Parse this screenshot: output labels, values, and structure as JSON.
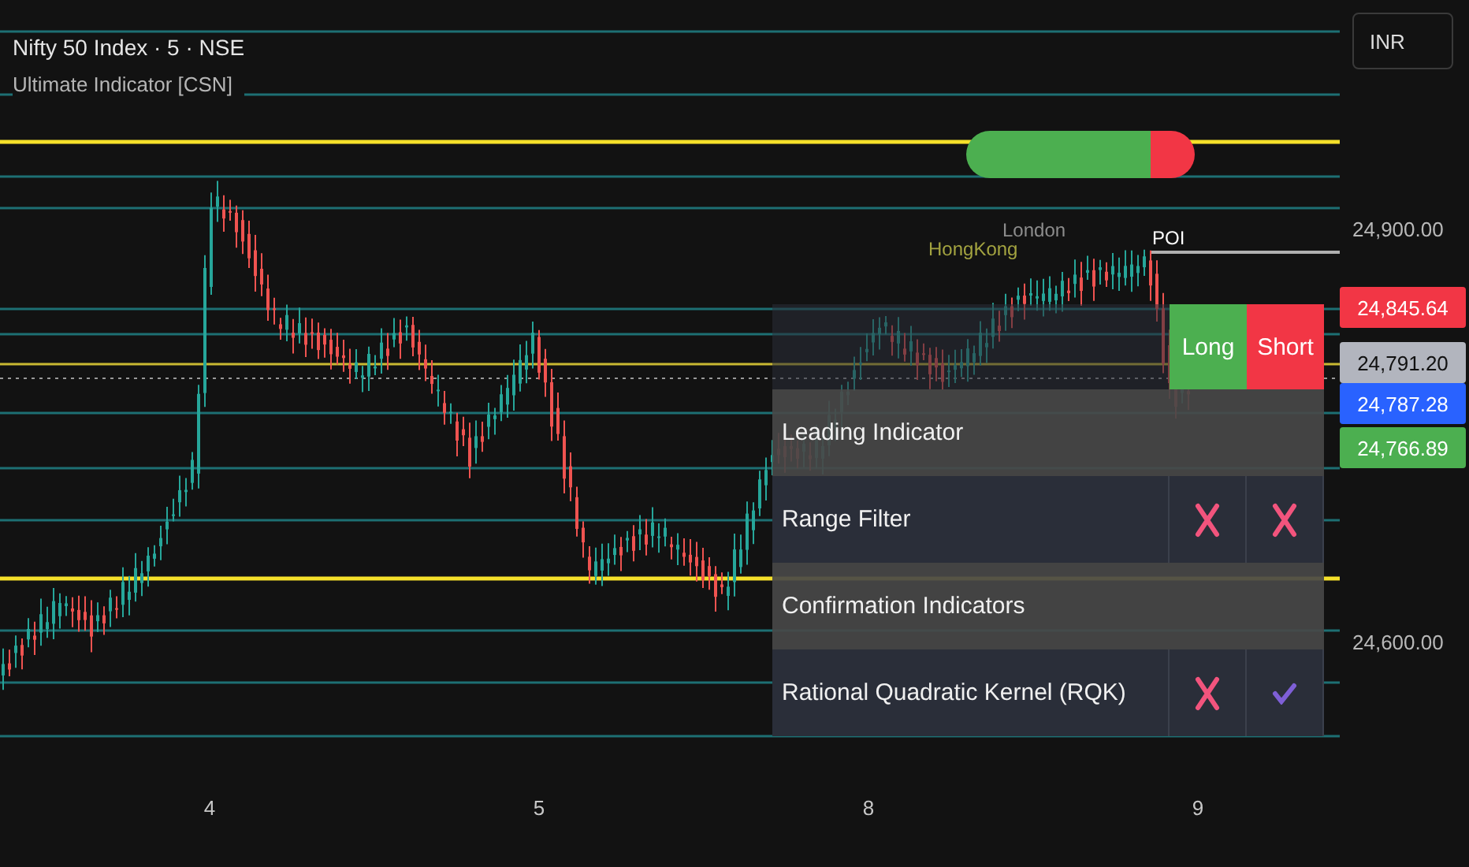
{
  "header": {
    "symbol": "Nifty 50 Index · 5 · NSE",
    "indicator": "Ultimate Indicator [CSN]"
  },
  "currency": "INR",
  "sessions": [
    {
      "label": "London",
      "color": "#8c8c8c"
    },
    {
      "label": "HongKong",
      "color": "#a3a340"
    }
  ],
  "marker": "POI",
  "price_axis": [
    {
      "text": "24,900.00",
      "kind": "tick"
    },
    {
      "text": "24,845.64",
      "kind": "badge",
      "color": "#f23645"
    },
    {
      "text": "24,791.20",
      "kind": "badge",
      "color": "#b2b5be"
    },
    {
      "text": "24,787.28",
      "kind": "badge",
      "color": "#2962ff"
    },
    {
      "text": "24,766.89",
      "kind": "badge",
      "color": "#4caf50"
    },
    {
      "text": "24,600.00",
      "kind": "tick"
    }
  ],
  "time_axis": [
    "4",
    "5",
    "8",
    "9"
  ],
  "signal_table": {
    "columns": [
      "Long",
      "Short"
    ],
    "rows": [
      {
        "kind": "section",
        "label": "Leading Indicator"
      },
      {
        "kind": "indicator",
        "label": "Range Filter",
        "long": false,
        "short": false
      },
      {
        "kind": "section",
        "label": "Confirmation Indicators"
      },
      {
        "kind": "indicator",
        "label": "Rational Quadratic Kernel (RQK)",
        "long": false,
        "short": true
      }
    ]
  }
}
